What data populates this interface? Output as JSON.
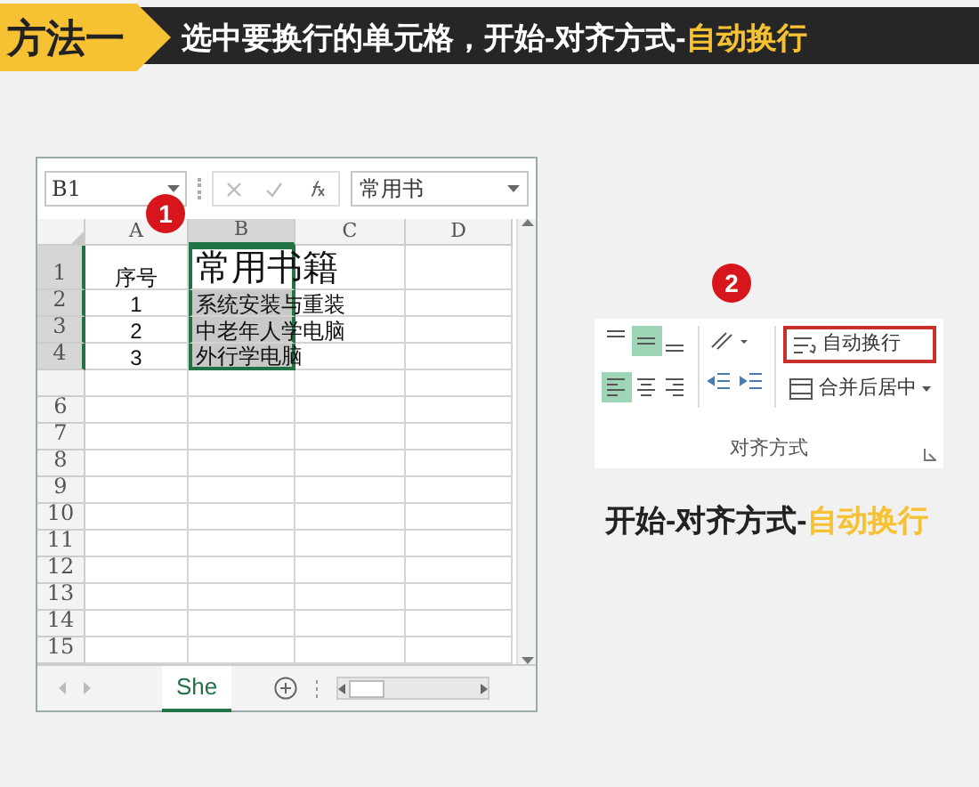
{
  "banner": {
    "tag": "方法一",
    "text": "选中要换行的单元格，开始-对齐方式-",
    "highlight": "自动换行"
  },
  "excel": {
    "badge": "1",
    "name_box": "B1",
    "formula_value": "常用书",
    "columns": [
      {
        "label": "A",
        "selected": false
      },
      {
        "label": "B",
        "selected": true
      },
      {
        "label": "C",
        "selected": false
      },
      {
        "label": "D",
        "selected": false
      }
    ],
    "rows": [
      {
        "header": "1",
        "selected": true,
        "cells": [
          "序号",
          "常用书籍",
          "",
          ""
        ]
      },
      {
        "header": "2",
        "selected": true,
        "cells": [
          "1",
          "系统安装与重装",
          "",
          ""
        ]
      },
      {
        "header": "3",
        "selected": true,
        "cells": [
          "2",
          "中老年人学电脑",
          "",
          ""
        ]
      },
      {
        "header": "4",
        "selected": true,
        "cells": [
          "3",
          "外行学电脑",
          "",
          ""
        ]
      },
      {
        "header": "",
        "selected": false,
        "cells": [
          "",
          "",
          "",
          ""
        ]
      },
      {
        "header": "6",
        "selected": false,
        "cells": [
          "",
          "",
          "",
          ""
        ]
      },
      {
        "header": "7",
        "selected": false,
        "cells": [
          "",
          "",
          "",
          ""
        ]
      },
      {
        "header": "8",
        "selected": false,
        "cells": [
          "",
          "",
          "",
          ""
        ]
      },
      {
        "header": "9",
        "selected": false,
        "cells": [
          "",
          "",
          "",
          ""
        ]
      },
      {
        "header": "10",
        "selected": false,
        "cells": [
          "",
          "",
          "",
          ""
        ]
      },
      {
        "header": "11",
        "selected": false,
        "cells": [
          "",
          "",
          "",
          ""
        ]
      },
      {
        "header": "12",
        "selected": false,
        "cells": [
          "",
          "",
          "",
          ""
        ]
      },
      {
        "header": "13",
        "selected": false,
        "cells": [
          "",
          "",
          "",
          ""
        ]
      },
      {
        "header": "14",
        "selected": false,
        "cells": [
          "",
          "",
          "",
          ""
        ]
      },
      {
        "header": "15",
        "selected": false,
        "cells": [
          "",
          "",
          "",
          ""
        ]
      }
    ],
    "sheet_tab": "She"
  },
  "ribbon": {
    "badge": "2",
    "align_buttons": [
      {
        "kind": "top",
        "selected": false
      },
      {
        "kind": "middle",
        "selected": true
      },
      {
        "kind": "bottom",
        "selected": false
      },
      {
        "kind": "left",
        "selected": true
      },
      {
        "kind": "center",
        "selected": false
      },
      {
        "kind": "right",
        "selected": false
      }
    ],
    "wrap_text": {
      "label": "自动换行",
      "highlighted": true
    },
    "merge": {
      "label": "合并后居中"
    },
    "group_label": "对齐方式"
  },
  "caption": {
    "text": "开始-对齐方式-",
    "highlight": "自动换行"
  }
}
